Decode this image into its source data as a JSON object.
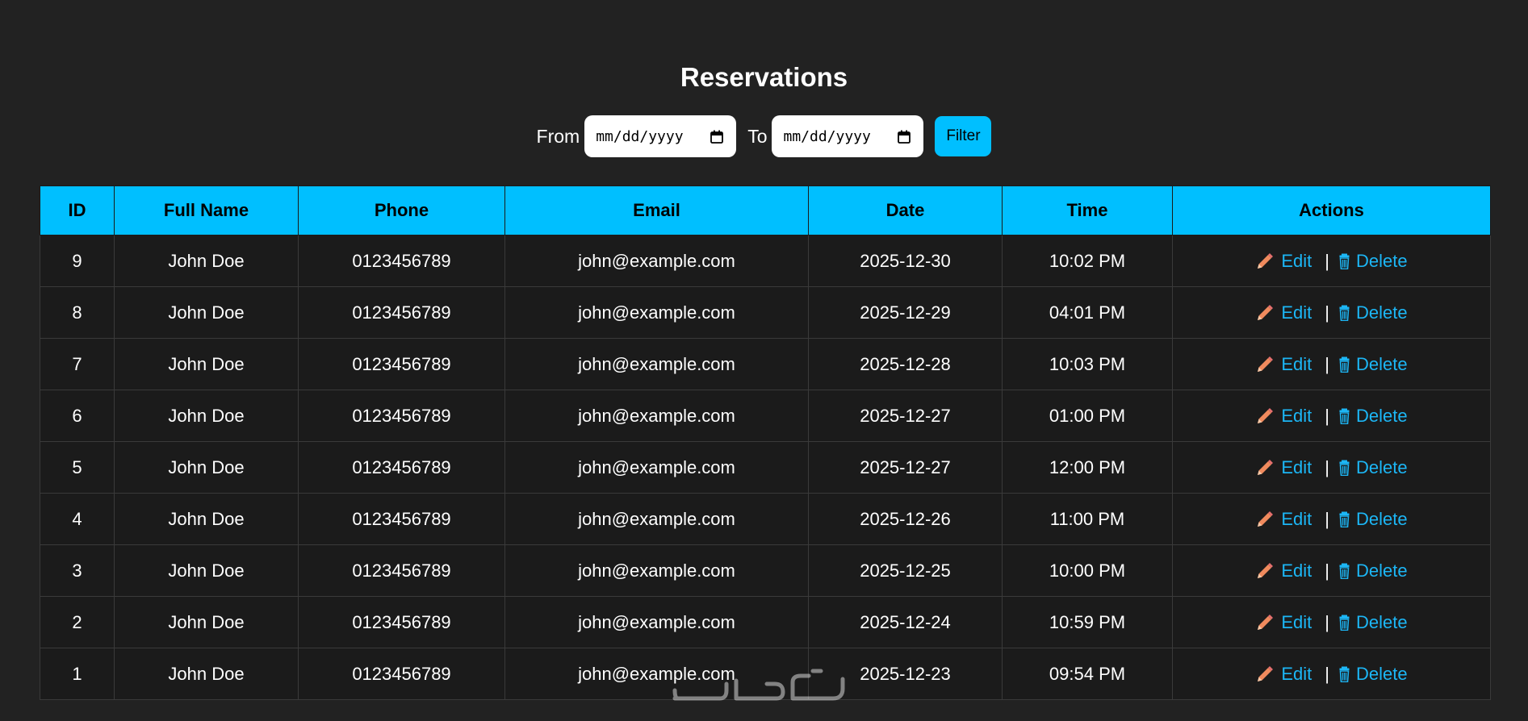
{
  "page": {
    "title": "Reservations"
  },
  "filter": {
    "from_label": "From",
    "to_label": "To",
    "from_placeholder": "mm/dd/yyyy",
    "to_placeholder": "mm/dd/yyyy",
    "button_label": "Filter"
  },
  "table": {
    "headers": [
      "ID",
      "Full Name",
      "Phone",
      "Email",
      "Date",
      "Time",
      "Actions"
    ],
    "edit_label": "Edit",
    "delete_label": "Delete",
    "separator": "|",
    "rows": [
      {
        "id": "9",
        "name": "John Doe",
        "phone": "0123456789",
        "email": "john@example.com",
        "date": "2025-12-30",
        "time": "10:02 PM"
      },
      {
        "id": "8",
        "name": "John Doe",
        "phone": "0123456789",
        "email": "john@example.com",
        "date": "2025-12-29",
        "time": "04:01 PM"
      },
      {
        "id": "7",
        "name": "John Doe",
        "phone": "0123456789",
        "email": "john@example.com",
        "date": "2025-12-28",
        "time": "10:03 PM"
      },
      {
        "id": "6",
        "name": "John Doe",
        "phone": "0123456789",
        "email": "john@example.com",
        "date": "2025-12-27",
        "time": "01:00 PM"
      },
      {
        "id": "5",
        "name": "John Doe",
        "phone": "0123456789",
        "email": "john@example.com",
        "date": "2025-12-27",
        "time": "12:00 PM"
      },
      {
        "id": "4",
        "name": "John Doe",
        "phone": "0123456789",
        "email": "john@example.com",
        "date": "2025-12-26",
        "time": "11:00 PM"
      },
      {
        "id": "3",
        "name": "John Doe",
        "phone": "0123456789",
        "email": "john@example.com",
        "date": "2025-12-25",
        "time": "10:00 PM"
      },
      {
        "id": "2",
        "name": "John Doe",
        "phone": "0123456789",
        "email": "john@example.com",
        "date": "2025-12-24",
        "time": "10:59 PM"
      },
      {
        "id": "1",
        "name": "John Doe",
        "phone": "0123456789",
        "email": "john@example.com",
        "date": "2025-12-23",
        "time": "09:54 PM"
      }
    ]
  },
  "colors": {
    "background": "#222222",
    "accent": "#00bfff",
    "link": "#1cb6f5",
    "pencil": "#f08a5d"
  },
  "icons": {
    "edit": "pencil-icon",
    "delete": "trash-icon",
    "date": "calendar-icon"
  }
}
